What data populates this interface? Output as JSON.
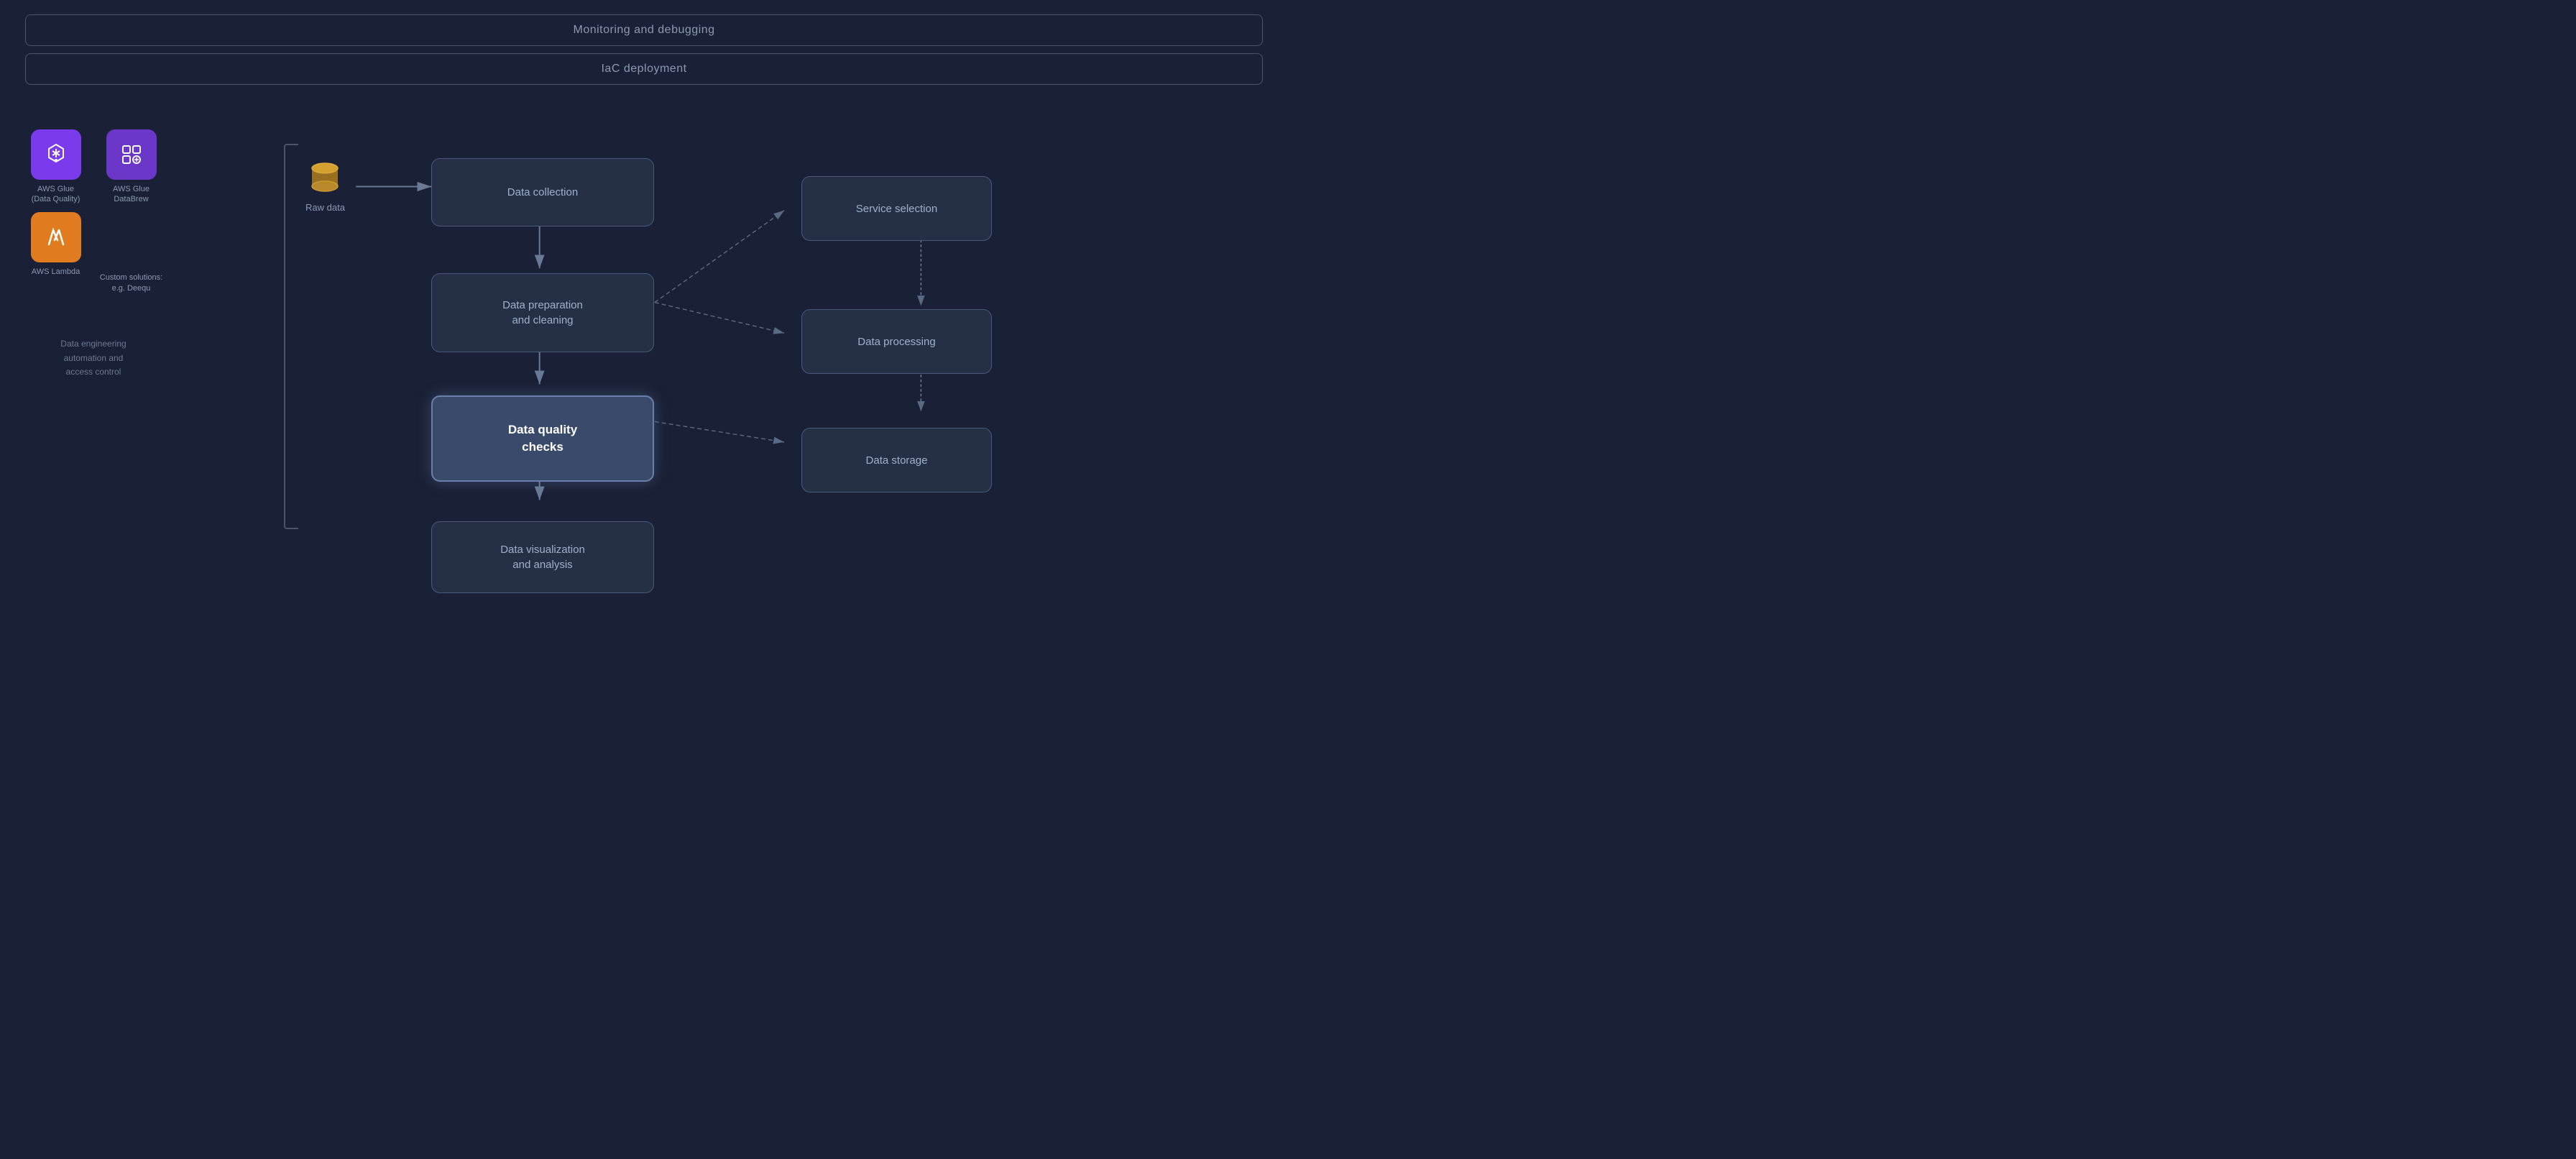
{
  "topBanners": [
    "Monitoring and debugging",
    "IaC deployment"
  ],
  "leftIcons": [
    {
      "label": "AWS Glue\n(Data Quality)",
      "color": "purple",
      "icon": "⬇"
    },
    {
      "label": "AWS Glue\nDataBrew",
      "color": "purple2",
      "icon": "⚙"
    },
    {
      "label": "AWS Lambda",
      "color": "orange",
      "icon": "λ"
    },
    {
      "label": "Custom solutions:\ne.g. Deequ",
      "color": "none",
      "icon": ""
    }
  ],
  "automationLabel": "Data engineering\nautomation and\naccess control",
  "rawDataLabel": "Raw data",
  "flowBoxes": [
    "Data collection",
    "Data preparation\nand cleaning",
    "Data quality\nchecks",
    "Data visualization\nand analysis"
  ],
  "rightBoxes": [
    "Service selection",
    "Data processing",
    "Data storage"
  ]
}
